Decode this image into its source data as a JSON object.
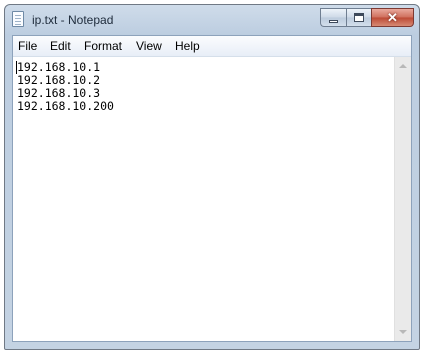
{
  "window": {
    "title": "ip.txt - Notepad"
  },
  "icons": {
    "app": "notepad-icon",
    "minimize": "minimize-icon",
    "maximize": "maximize-icon",
    "close": "close-icon",
    "scroll_up": "scroll-up-arrow-icon",
    "scroll_down": "scroll-down-arrow-icon"
  },
  "caption": {
    "close_glyph": "✕"
  },
  "menu": {
    "file": "File",
    "edit": "Edit",
    "format": "Format",
    "view": "View",
    "help": "Help"
  },
  "document": {
    "lines": [
      "192.168.10.1",
      "192.168.10.2",
      "192.168.10.3",
      "192.168.10.200"
    ]
  }
}
